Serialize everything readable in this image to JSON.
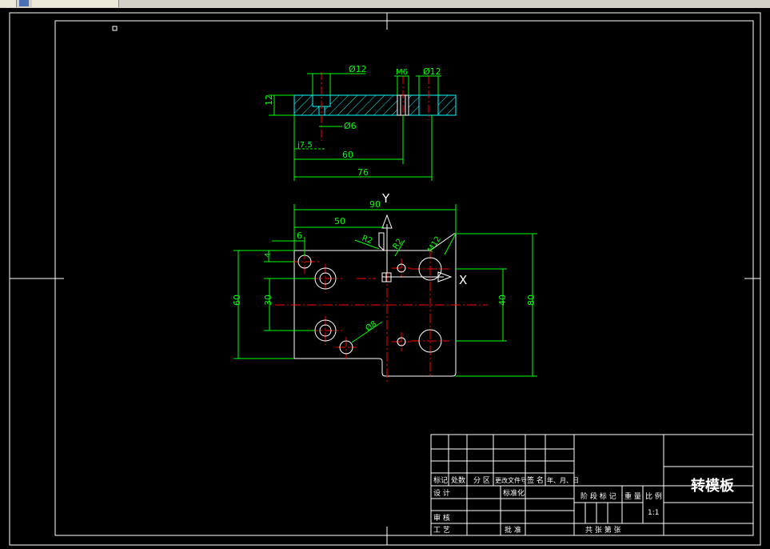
{
  "drawing": {
    "title": "转模板",
    "scale": "1:1",
    "axis_x": "X",
    "axis_y": "Y"
  },
  "section_view": {
    "dim_hole1": "Ø12",
    "dim_thread": "M6",
    "dim_hole2": "Ø12",
    "dim_thickness": "12",
    "dim_small": "Ø6",
    "dim_depth": "j7.5",
    "dim_60": "60",
    "dim_76": "76"
  },
  "plan_view": {
    "dim_90": "90",
    "dim_50": "50",
    "dim_6": "6",
    "dim_r2": "R2",
    "dim_r2b": "R2",
    "dim_m12": "M12",
    "dim_4": "4",
    "dim_60": "60",
    "dim_30": "30",
    "dim_40": "40",
    "dim_80": "80",
    "dim_d8": "Ø8"
  },
  "title_block": {
    "h_mark": "标记",
    "h_count": "处数",
    "h_zone": "分 区",
    "h_docno": "更改文件号",
    "h_sign": "签 名",
    "h_date": "年、月、日",
    "design": "设 计",
    "standard": "标准化",
    "stage": "阶 段 标 记",
    "weight": "重 量",
    "ratio": "比 例",
    "review": "审 核",
    "process": "工 艺",
    "approve": "批 准",
    "sheets": "共  张  第  张"
  },
  "colors": {
    "background": "#000000",
    "frame": "#ffffff",
    "dimension": "#00ff00",
    "center": "#ff0000",
    "hatch": "#00ffff"
  }
}
